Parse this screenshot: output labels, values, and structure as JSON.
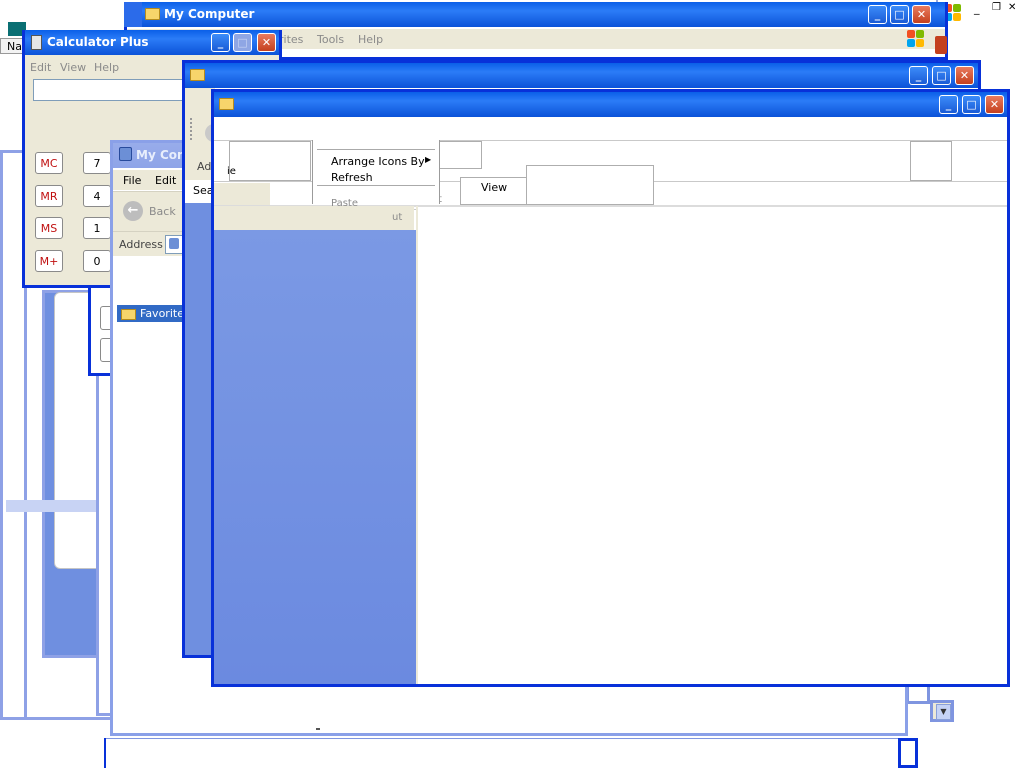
{
  "desktop": {
    "header_name_label": "Nam",
    "restore_glyph": "❐",
    "close_glyph": "✕"
  },
  "my_computer_back": {
    "title": "My Computer",
    "menu": {
      "favorites": "rites",
      "tools": "Tools",
      "help": "Help"
    }
  },
  "calculator": {
    "title": "Calculator Plus",
    "menu": {
      "edit": "Edit",
      "view": "View",
      "help": "Help"
    },
    "display_value": "",
    "memory_buttons": [
      "MC",
      "MR",
      "MS",
      "M+"
    ],
    "digit_buttons": [
      "7",
      "4",
      "1",
      "0"
    ]
  },
  "my_computer_front": {
    "title": "My Com",
    "menu": {
      "file": "File",
      "edit": "Edit"
    },
    "back_label": "Back",
    "address_label": "Address",
    "favorites_label": "Favorites"
  },
  "folder_window_1": {
    "title": "",
    "address_fragment": "Ad",
    "search_fragment": "Sear"
  },
  "folder_window_2": {
    "title": "",
    "context_menu": {
      "items": [
        "Arrange Icons By",
        "Refresh",
        "Paste"
      ]
    },
    "view_label": "View",
    "fragments": {
      "a": "ie",
      "b": "t",
      "c": "ut"
    }
  },
  "window_controls": {
    "minimize": "_",
    "maximize": "□",
    "close": "✕"
  },
  "colors": {
    "xp_blue": "#0831d9",
    "title_gradient_top": "#0a5fe8",
    "side_panel": "#6f8fe0",
    "menu_bg": "#ece9d8",
    "memory_red": "#c01010"
  }
}
